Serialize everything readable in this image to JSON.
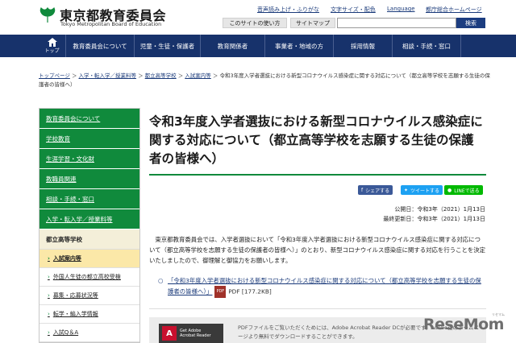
{
  "header": {
    "logo_jp": "東京都教育委員会",
    "logo_en": "Tokyo Metropolitan Board of Education",
    "util_links": [
      "音声読み上げ・ふりがな",
      "文字サイズ・配色",
      "Language",
      "都庁総合ホームページ"
    ],
    "buttons": [
      "このサイトの使い方",
      "サイトマップ"
    ],
    "search_button": "検索",
    "brand_green": "#108a3c"
  },
  "nav": {
    "top_label": "トップ",
    "items": [
      "教育委員会について",
      "児童・生徒・保護者",
      "教育関係者",
      "事業者・地域の方",
      "採用情報",
      "相談・手続・窓口"
    ],
    "color": "#17326b"
  },
  "breadcrumb": {
    "links": [
      "トップページ",
      "入学・転入学／授業料等",
      "都立高等学校",
      "入試案内等"
    ],
    "current": "令和3年度入学者選抜における新型コロナウイルス感染症に関する対応について（都立高等学校を志願する生徒の保護者の皆様へ）"
  },
  "sidebar": {
    "items": [
      "教育委員会について",
      "学校教育",
      "生涯学習・文化財",
      "教職員関連",
      "相談・手続・窓口",
      "入学・転入学／授業料等"
    ],
    "section": "都立高等学校",
    "sub_items": [
      "入試案内等",
      "外国人生徒の都立高校受検",
      "募集・応募状況等",
      "転学・編入学情報",
      "入試Q＆A"
    ],
    "active_index": 0
  },
  "main": {
    "title": "令和3年度入学者選抜における新型コロナウイルス感染症に関する対応について（都立高等学校を志願する生徒の保護者の皆様へ）",
    "share": [
      "シェアする",
      "ツイートする",
      "LINEで送る"
    ],
    "published": "公開日：令和3年（2021）1月13日",
    "updated": "最終更新日：令和3年（2021）1月13日",
    "body": "東京都教育委員会では、入学者選抜において「令和3年度入学者選抜における新型コロナウイルス感染症に関する対応について（都立高等学校を志願する生徒の保護者の皆様へ）」のとおり、新型コロナウイルス感染症に関する対応を行うことを決定いたしましたので、御理解と御協力をお願いします。",
    "doc_link": "「令和3年度入学者選抜における新型コロナウイルス感染症に関する対応について（都立高等学校を志願する生徒の保護者の皆様へ）」",
    "pdf_label": "PDF",
    "pdf_size": "PDF [177.2KB]",
    "acrobat_badge_line1": "Get Adobe",
    "acrobat_badge_line2": "Acrobat Reader",
    "acrobat_note": "PDFファイルをご覧いただくためには、Adobe Acrobat Reader DCが必要です。Adobe社のホームページより無料でダウンロードすることができます。"
  },
  "watermark": {
    "text": "ReseMom",
    "sub": "リセマム"
  }
}
